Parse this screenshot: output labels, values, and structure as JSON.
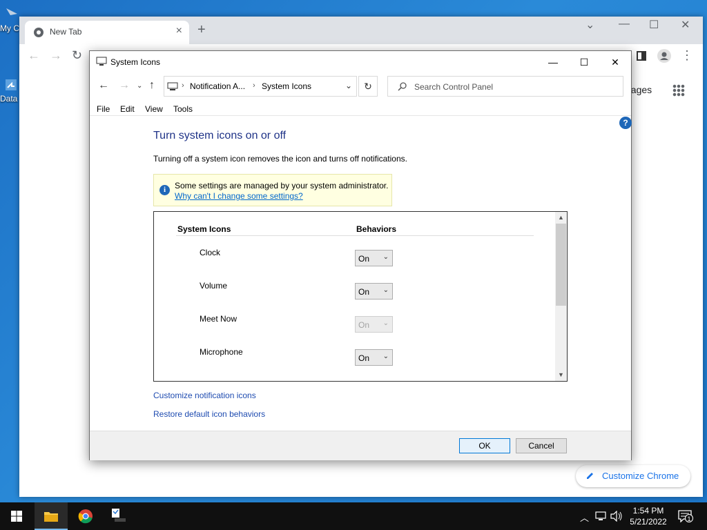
{
  "desktop": {
    "icons": [
      {
        "label": "My C"
      },
      {
        "label": "Data"
      }
    ]
  },
  "chrome": {
    "tab_title": "New Tab",
    "tab_close": "×",
    "new_tab": "+",
    "images_link": "nages",
    "customize_label": "Customize Chrome",
    "accent": "#1a73e8"
  },
  "dialog": {
    "title": "System Icons",
    "breadcrumbs": [
      "Notification A...",
      "System Icons"
    ],
    "search_placeholder": "Search Control Panel",
    "menu": [
      "File",
      "Edit",
      "View",
      "Tools"
    ],
    "help": "?",
    "heading": "Turn system icons on or off",
    "subtext": "Turning off a system icon removes the icon and turns off notifications.",
    "admin_note": {
      "text": "Some settings are managed by your system administrator.",
      "link": "Why can't I change some settings?"
    },
    "columns": {
      "icons": "System Icons",
      "behaviors": "Behaviors"
    },
    "rows": [
      {
        "name": "Clock",
        "value": "On",
        "disabled": false
      },
      {
        "name": "Volume",
        "value": "On",
        "disabled": false
      },
      {
        "name": "Meet Now",
        "value": "On",
        "disabled": true
      },
      {
        "name": "Microphone",
        "value": "On",
        "disabled": false
      }
    ],
    "links": [
      "Customize notification icons",
      "Restore default icon behaviors"
    ],
    "ok_label": "OK",
    "cancel_label": "Cancel",
    "heading_color": "#1e3287"
  },
  "taskbar": {
    "time": "1:54 PM",
    "date": "5/21/2022",
    "notification_count": "1"
  }
}
